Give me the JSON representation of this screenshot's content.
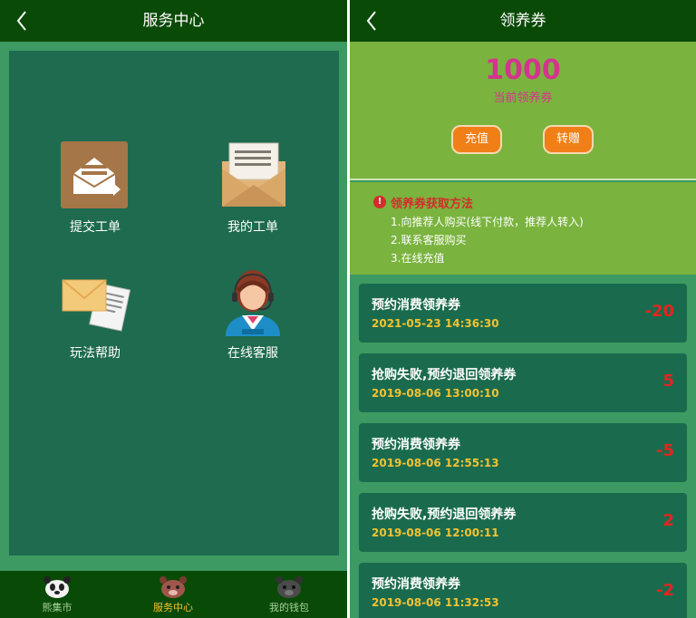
{
  "left": {
    "header": {
      "title": "服务中心"
    },
    "services": [
      {
        "label": "提交工单",
        "icon": "submit-ticket-icon"
      },
      {
        "label": "我的工单",
        "icon": "envelope-icon"
      },
      {
        "label": "玩法帮助",
        "icon": "help-letter-icon"
      },
      {
        "label": "在线客服",
        "icon": "customer-service-icon"
      }
    ],
    "nav": [
      {
        "label": "熊集市",
        "icon": "panda-icon"
      },
      {
        "label": "服务中心",
        "icon": "bear-icon",
        "active": true
      },
      {
        "label": "我的钱包",
        "icon": "wallet-bear-icon"
      }
    ]
  },
  "right": {
    "header": {
      "title": "领养券"
    },
    "balance": {
      "value": "1000",
      "label": "当前领养券"
    },
    "buttons": {
      "recharge": "充值",
      "gift": "转赠"
    },
    "methods": {
      "title": "领养券获取方法",
      "items": [
        "1.向推荐人购买(线下付款，推荐人转入)",
        "2.联系客服购买",
        "3.在线充值"
      ]
    },
    "records": [
      {
        "title": "预约消费领养券",
        "time": "2021-05-23 14:36:30",
        "amount": "-20"
      },
      {
        "title": "抢购失败,预约退回领养券",
        "time": "2019-08-06 13:00:10",
        "amount": "5"
      },
      {
        "title": "预约消费领养券",
        "time": "2019-08-06 12:55:13",
        "amount": "-5"
      },
      {
        "title": "抢购失败,预约退回领养券",
        "time": "2019-08-06 12:00:11",
        "amount": "2"
      },
      {
        "title": "预约消费领养券",
        "time": "2019-08-06 11:32:53",
        "amount": "-2"
      }
    ]
  },
  "colors": {
    "header": "#0a4a07",
    "panel_bg": "#3c9a62",
    "board": "#1e6b4f",
    "balance_bg": "#7ab33e",
    "accent_pink": "#d4348f",
    "button_orange": "#f07f18",
    "amount_red": "#e2261d",
    "time_yellow": "#f3c232"
  }
}
